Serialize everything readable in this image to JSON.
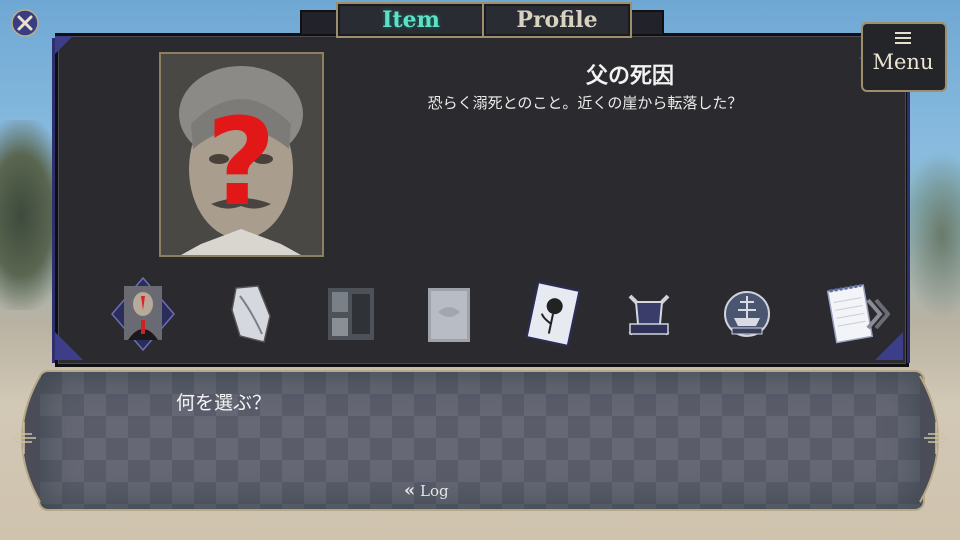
{
  "tabs": [
    {
      "label": "Item",
      "active": true
    },
    {
      "label": "Profile",
      "active": false
    }
  ],
  "menu": {
    "label": "Menu"
  },
  "selected_item": {
    "title": "父の死因",
    "description": "恐らく溺死とのこと。近くの崖から転落した？",
    "portrait_overlay": "?"
  },
  "item_slots": [
    {
      "icon": "father-portrait-icon",
      "selected": true
    },
    {
      "icon": "torn-cloth-icon",
      "selected": false
    },
    {
      "icon": "ship-interior-photo-icon",
      "selected": false
    },
    {
      "icon": "parchment-scrap-icon",
      "selected": false
    },
    {
      "icon": "flower-card-icon",
      "selected": false
    },
    {
      "icon": "cutlass-emblem-icon",
      "selected": false
    },
    {
      "icon": "pirate-ship-emblem-icon",
      "selected": false
    },
    {
      "icon": "notepad-icon",
      "selected": false
    }
  ],
  "dialog": {
    "text": "何を選ぶ？",
    "log_label": "Log"
  },
  "colors": {
    "panel": "#2b2b2f",
    "accent_teal": "#5fe0c8",
    "gold_border": "#9c8f6a",
    "indigo_trim": "#3c3e8a"
  }
}
